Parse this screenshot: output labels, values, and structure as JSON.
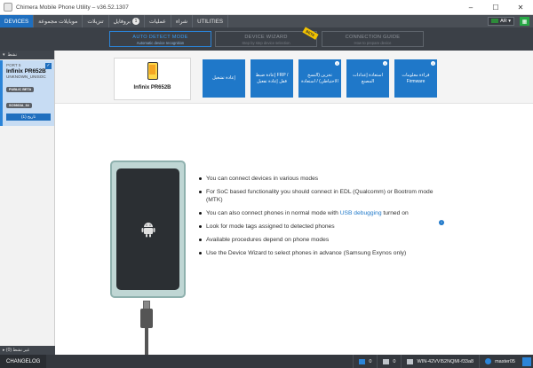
{
  "window": {
    "title": "Chimera Mobile Phone Utility – v36.52.1307",
    "minimize": "–",
    "maximize": "☐",
    "close": "✕"
  },
  "menu": {
    "items": [
      {
        "label": "DEVICES",
        "active": true
      },
      {
        "label": "موبايلات مجموعة"
      },
      {
        "label": "تنزيلات"
      },
      {
        "label": "بروفايل",
        "badge": "1"
      },
      {
        "label": "عمليات"
      },
      {
        "label": "شراء"
      },
      {
        "label": "UTILITIES"
      }
    ],
    "language": "AR",
    "grid_icon": "grid-icon"
  },
  "modes": {
    "auto": {
      "title": "AUTO DETECT MODE",
      "subtitle": "Automatic device recognition"
    },
    "wizard": {
      "title": "DEVICE WIZARD",
      "subtitle": "Step by step device selection",
      "ribbon": "BETA"
    },
    "guide": {
      "title": "CONNECTION GUIDE",
      "subtitle": "How to prepare device"
    }
  },
  "sidebar": {
    "header": "نشط",
    "device": {
      "port": "PORT 5",
      "model": "Infinix PR652B",
      "sub": "UNKNOWN_UNISOC",
      "tags": [
        "PUBLIC BETA",
        "SC9863A_64"
      ],
      "history_button": "تاريخ (1)"
    },
    "footer": "غير نشط (0)"
  },
  "device_panel": {
    "name": "Infinix PR652B"
  },
  "actions": [
    {
      "label": "إعادة تشغيل"
    },
    {
      "label": "إعادة ضبط FRP / قفل إعادة تفعيل"
    },
    {
      "label": "تخزين (النسخ الاحتياطي) / استعادة"
    },
    {
      "label": "استعادة إعدادات المصنع"
    },
    {
      "label": "قراءة معلومات Firmware"
    }
  ],
  "tips": [
    {
      "text": "You can connect devices in various modes"
    },
    {
      "text": "For SoC based functionality you should connect in EDL (Qualcomm) or Bootrom mode (MTK)"
    },
    {
      "pre": "You can also connect phones in normal mode with ",
      "link": "USB debugging",
      "post": " turned on"
    },
    {
      "text": "Look for mode tags assigned to detected phones"
    },
    {
      "text": "Available procedures depend on phone modes"
    },
    {
      "text": "Use the Device Wizard to select phones in advance (Samsung Exynos only)"
    }
  ],
  "status": {
    "changelog": "CHANGELOG",
    "mail_count": "0",
    "msg_count": "0",
    "computer": "WIN-42VVI52NQMI-f33a8",
    "user": "master05"
  },
  "colors": {
    "accent": "#1f78c9",
    "menubar": "#4a4f56",
    "statusbar": "#34383e"
  }
}
